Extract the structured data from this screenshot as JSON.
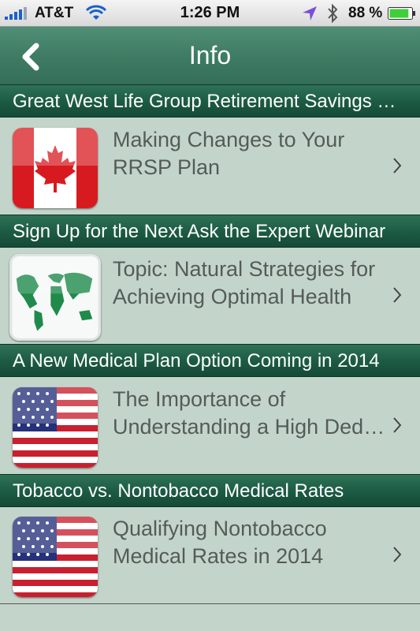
{
  "status_bar": {
    "carrier": "AT&T",
    "time": "1:26 PM",
    "battery_percent": "88 %",
    "battery_level": 0.88
  },
  "nav": {
    "title": "Info"
  },
  "sections": [
    {
      "header": "Great West Life Group Retirement Savings Plan",
      "item": {
        "line1": "Making Changes to Your",
        "line2": "RRSP Plan",
        "image": "canada-flag"
      }
    },
    {
      "header": "Sign Up for the Next Ask the Expert Webinar",
      "item": {
        "line1": "Topic: Natural Strategies for",
        "line2": "Achieving Optimal Health",
        "image": "world-map"
      }
    },
    {
      "header": "A New Medical Plan Option Coming in 2014",
      "item": {
        "line1": "The Importance of",
        "line2": "Understanding a High Deductible",
        "image": "us-flag"
      }
    },
    {
      "header": "Tobacco vs. Nontobacco Medical Rates",
      "item": {
        "line1": "Qualifying Nontobacco",
        "line2": "Medical Rates in 2014",
        "image": "us-flag"
      }
    }
  ],
  "colors": {
    "nav": "#3f7c64",
    "section_header": "#1c5a43",
    "row_background": "#c3d5cb",
    "row_text": "#555b58"
  }
}
